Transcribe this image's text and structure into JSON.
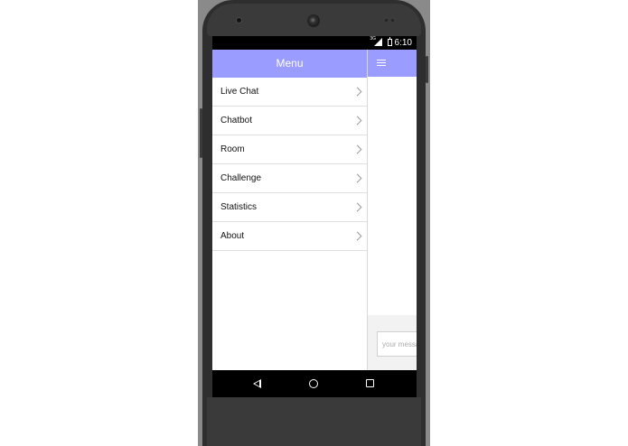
{
  "status_bar": {
    "time": "6:10",
    "network": "3G"
  },
  "drawer": {
    "title": "Menu",
    "items": [
      {
        "label": "Live Chat"
      },
      {
        "label": "Chatbot"
      },
      {
        "label": "Room"
      },
      {
        "label": "Challenge"
      },
      {
        "label": "Statistics"
      },
      {
        "label": "About"
      }
    ]
  },
  "chat": {
    "input_placeholder": "your message"
  },
  "colors": {
    "header": "#9b9cff",
    "frame": "#2e2e2e"
  },
  "icons": [
    "hamburger-icon",
    "chevron-right-icon",
    "back-icon",
    "home-icon",
    "recents-icon",
    "battery-icon",
    "signal-icon"
  ]
}
